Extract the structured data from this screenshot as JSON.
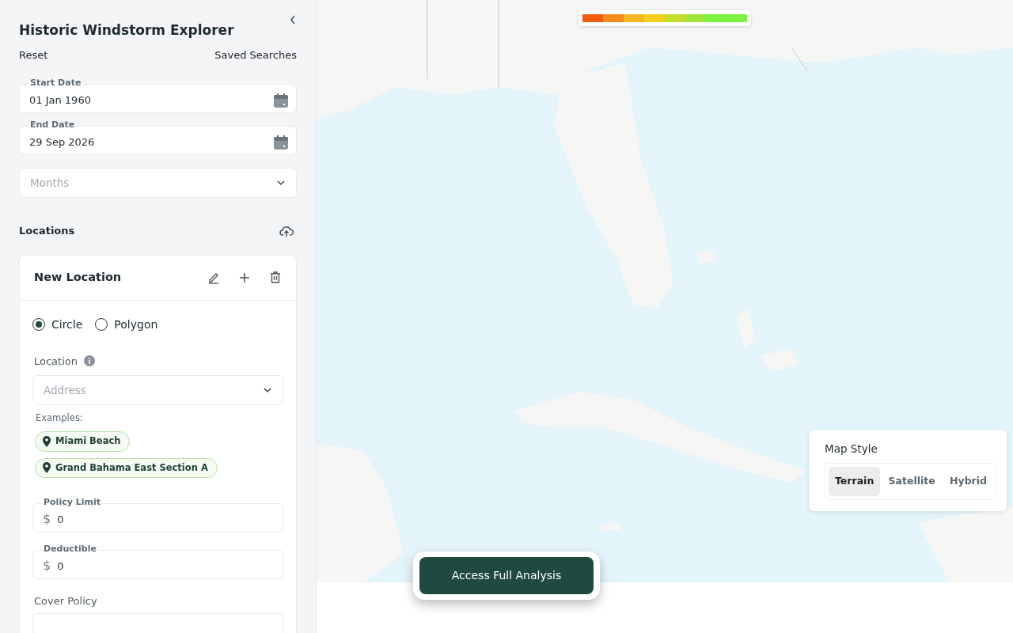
{
  "sidebar": {
    "title": "Historic Windstorm Explorer",
    "reset": "Reset",
    "saved_searches": "Saved Searches",
    "date_fields": [
      {
        "label": "Start Date",
        "value": "01 Jan 1960"
      },
      {
        "label": "End Date",
        "value": "29 Sep 2026"
      }
    ],
    "months": {
      "placeholder": "Months"
    },
    "locations_title": "Locations",
    "location_card": {
      "title": "New Location",
      "shape_options": [
        {
          "label": "Circle",
          "selected": true
        },
        {
          "label": "Polygon",
          "selected": false
        }
      ],
      "location_label": "Location",
      "address": {
        "placeholder": "Address"
      },
      "examples_label": "Examples:",
      "examples": [
        "Miami Beach",
        "Grand Bahama East Section A"
      ],
      "money_fields": [
        {
          "label": "Policy Limit",
          "currency": "$",
          "value": "0"
        },
        {
          "label": "Deductible",
          "currency": "$",
          "value": "0"
        }
      ],
      "cover_policy_label": "Cover Policy"
    }
  },
  "map": {
    "legend": [
      {
        "color": "#f25a12"
      },
      {
        "color": "#f5891c"
      },
      {
        "color": "#f5b51e"
      },
      {
        "color": "#f4d01c"
      },
      {
        "color": "#c6dc2c"
      },
      {
        "color": "#a0e63a"
      },
      {
        "color": "#7cf33f"
      },
      {
        "color": "#7cf33f"
      }
    ],
    "map_style": {
      "title": "Map Style",
      "options": [
        {
          "label": "Terrain",
          "selected": true
        },
        {
          "label": "Satellite",
          "selected": false
        },
        {
          "label": "Hybrid",
          "selected": false
        }
      ]
    },
    "action_button": "Access Full Analysis"
  }
}
